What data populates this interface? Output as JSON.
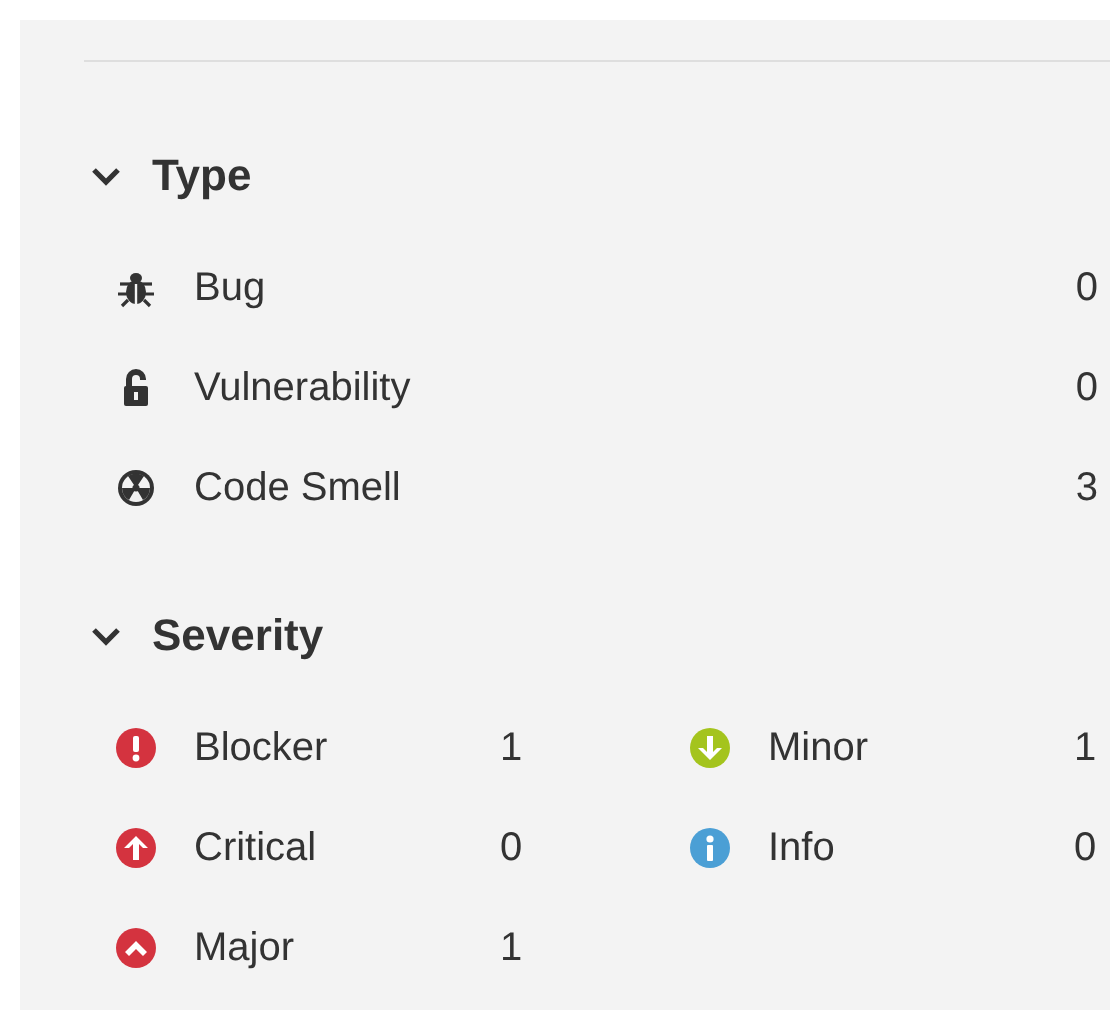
{
  "sections": [
    {
      "title": "Type",
      "expanded": true,
      "kind": "list",
      "items": [
        {
          "kind": "bug",
          "label": "Bug",
          "count": "0"
        },
        {
          "kind": "lock",
          "label": "Vulnerability",
          "count": "0"
        },
        {
          "kind": "smell",
          "label": "Code Smell",
          "count": "3"
        }
      ]
    },
    {
      "title": "Severity",
      "expanded": true,
      "kind": "grid",
      "items": [
        {
          "kind": "blocker",
          "label": "Blocker",
          "count": "1"
        },
        {
          "kind": "minor",
          "label": "Minor",
          "count": "1"
        },
        {
          "kind": "critical",
          "label": "Critical",
          "count": "0"
        },
        {
          "kind": "info",
          "label": "Info",
          "count": "0"
        },
        {
          "kind": "major",
          "label": "Major",
          "count": "1"
        }
      ]
    }
  ]
}
